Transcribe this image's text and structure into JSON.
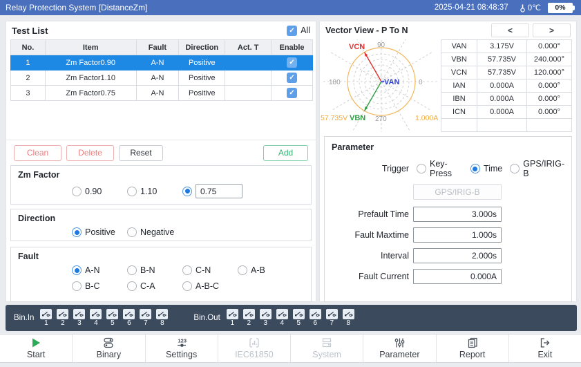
{
  "titlebar": {
    "title": "Relay Protection System [DistanceZm]",
    "datetime": "2025-04-21 08:48:37",
    "temperature": "0℃",
    "battery": "0%"
  },
  "test_list": {
    "title": "Test List",
    "all_label": "All",
    "all_checked": true,
    "columns": [
      "No.",
      "Item",
      "Fault",
      "Direction",
      "Act. T",
      "Enable"
    ],
    "rows": [
      {
        "no": "1",
        "item": "Zm Factor0.90",
        "fault": "A-N",
        "direction": "Positive",
        "act_t": "",
        "enabled": true,
        "selected": true
      },
      {
        "no": "2",
        "item": "Zm Factor1.10",
        "fault": "A-N",
        "direction": "Positive",
        "act_t": "",
        "enabled": true,
        "selected": false
      },
      {
        "no": "3",
        "item": "Zm Factor0.75",
        "fault": "A-N",
        "direction": "Positive",
        "act_t": "",
        "enabled": true,
        "selected": false
      }
    ],
    "buttons": {
      "clean": "Clean",
      "delete": "Delete",
      "reset": "Reset",
      "add": "Add"
    }
  },
  "zm_factor": {
    "title": "Zm Factor",
    "options": [
      {
        "label": "0.90",
        "selected": false
      },
      {
        "label": "1.10",
        "selected": false
      }
    ],
    "custom_selected": true,
    "custom_value": "0.75"
  },
  "direction": {
    "title": "Direction",
    "options": [
      {
        "label": "Positive",
        "selected": true
      },
      {
        "label": "Negative",
        "selected": false
      }
    ]
  },
  "fault": {
    "title": "Fault",
    "options": [
      {
        "label": "A-N",
        "selected": true
      },
      {
        "label": "B-N",
        "selected": false
      },
      {
        "label": "C-N",
        "selected": false
      },
      {
        "label": "A-B",
        "selected": false
      },
      {
        "label": "B-C",
        "selected": false
      },
      {
        "label": "C-A",
        "selected": false
      },
      {
        "label": "A-B-C",
        "selected": false
      }
    ]
  },
  "vector_view": {
    "title": "Vector View - P To N",
    "prev_label": "<",
    "next_label": ">",
    "chart": {
      "type": "polar-vector",
      "axis_labels": {
        "top": "90",
        "left": "180",
        "right": "0",
        "bottom": "270"
      },
      "voltage_scale": "57.735V",
      "current_scale": "1.000A",
      "vectors": [
        {
          "name": "VAN",
          "magnitude": "3.175V",
          "angle_deg": 0,
          "color": "#2f3fd3"
        },
        {
          "name": "VBN",
          "magnitude": "57.735V",
          "angle_deg": 240,
          "color": "#2e9e44"
        },
        {
          "name": "VCN",
          "magnitude": "57.735V",
          "angle_deg": 120,
          "color": "#e03131"
        }
      ]
    },
    "table": [
      {
        "name": "VAN",
        "value": "3.175V",
        "angle": "0.000°"
      },
      {
        "name": "VBN",
        "value": "57.735V",
        "angle": "240.000°"
      },
      {
        "name": "VCN",
        "value": "57.735V",
        "angle": "120.000°"
      },
      {
        "name": "IAN",
        "value": "0.000A",
        "angle": "0.000°"
      },
      {
        "name": "IBN",
        "value": "0.000A",
        "angle": "0.000°"
      },
      {
        "name": "ICN",
        "value": "0.000A",
        "angle": "0.000°"
      }
    ]
  },
  "parameter": {
    "title": "Parameter",
    "trigger_label": "Trigger",
    "trigger_options": [
      {
        "label": "Key-Press",
        "selected": false
      },
      {
        "label": "Time",
        "selected": true
      },
      {
        "label": "GPS/IRIG-B",
        "selected": false
      }
    ],
    "gps_button": "GPS/IRIG-B",
    "fields": [
      {
        "label": "Prefault Time",
        "value": "3.000s"
      },
      {
        "label": "Fault Maxtime",
        "value": "1.000s"
      },
      {
        "label": "Interval",
        "value": "2.000s"
      },
      {
        "label": "Fault Current",
        "value": "0.000A"
      }
    ]
  },
  "bin_bar": {
    "bin_in_label": "Bin.In",
    "bin_out_label": "Bin.Out",
    "channels": [
      "1",
      "2",
      "3",
      "4",
      "5",
      "6",
      "7",
      "8"
    ]
  },
  "toolbar": {
    "items": [
      {
        "label": "Start",
        "disabled": false
      },
      {
        "label": "Binary",
        "disabled": false
      },
      {
        "label": "Settings",
        "disabled": false
      },
      {
        "label": "IEC61850",
        "disabled": true
      },
      {
        "label": "System",
        "disabled": true
      },
      {
        "label": "Parameter",
        "disabled": false
      },
      {
        "label": "Report",
        "disabled": false
      },
      {
        "label": "Exit",
        "disabled": false
      }
    ]
  },
  "colors": {
    "titlebar": "#4a70bd",
    "selected_row": "#1e88e5",
    "checkbox": "#5f9fe8",
    "vector_red": "#e03131",
    "vector_green": "#2e9e44",
    "vector_blue": "#2f3fd3",
    "scale_orange": "#f0a93c",
    "bin_bar": "#3c4a5d",
    "start_green": "#2bab57"
  }
}
